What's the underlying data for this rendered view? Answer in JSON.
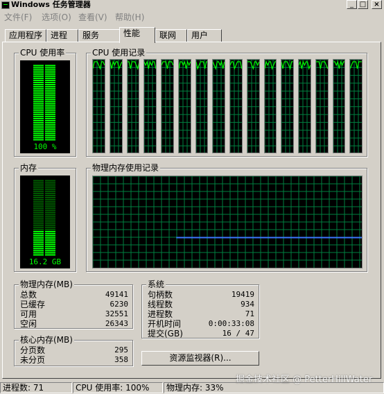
{
  "window": {
    "title": "Windows 任务管理器",
    "minimize_glyph": "_",
    "maximize_glyph": "□",
    "close_glyph": "×"
  },
  "menu": [
    {
      "label": "文件(F)"
    },
    {
      "label": "选项(O)"
    },
    {
      "label": "查看(V)"
    },
    {
      "label": "帮助(H)"
    }
  ],
  "tabs": [
    {
      "label": "应用程序",
      "active": false
    },
    {
      "label": "进程",
      "active": false
    },
    {
      "label": "服务",
      "active": false
    },
    {
      "label": "性能",
      "active": true
    },
    {
      "label": "联网",
      "active": false
    },
    {
      "label": "用户",
      "active": false
    }
  ],
  "cpu_usage": {
    "label": "CPU 使用率",
    "value_text": "100 %",
    "percent": 100
  },
  "cpu_history": {
    "label": "CPU 使用记录",
    "core_count": 16
  },
  "memory": {
    "label": "内存",
    "value_text": "16.2 GB",
    "fraction": 0.33
  },
  "memory_history": {
    "label": "物理内存使用记录",
    "level_fraction": 0.33
  },
  "physical_memory": {
    "label": "物理内存(MB)",
    "rows": [
      {
        "label": "总数",
        "value": "49141"
      },
      {
        "label": "已缓存",
        "value": "6230"
      },
      {
        "label": "可用",
        "value": "32551"
      },
      {
        "label": "空闲",
        "value": "26343"
      }
    ]
  },
  "kernel_memory": {
    "label": "核心内存(MB)",
    "rows": [
      {
        "label": "分页数",
        "value": "295"
      },
      {
        "label": "未分页",
        "value": "358"
      }
    ]
  },
  "system": {
    "label": "系统",
    "rows": [
      {
        "label": "句柄数",
        "value": "19419"
      },
      {
        "label": "线程数",
        "value": "934"
      },
      {
        "label": "进程数",
        "value": "71"
      },
      {
        "label": "开机时间",
        "value": "0:00:33:08"
      },
      {
        "label": "提交(GB)",
        "value": "16 / 47"
      }
    ]
  },
  "resource_monitor_button": "资源监视器(R)...",
  "status_bar": {
    "processes": "进程数: 71",
    "cpu": "CPU 使用率: 100%",
    "memory": "物理内存: 33%"
  },
  "watermark": "掘金技术社区 @ PetterHillWater",
  "colors": {
    "meter_green": "#00ff00",
    "grid_green": "#008040",
    "memory_line": "#3c78ff"
  }
}
